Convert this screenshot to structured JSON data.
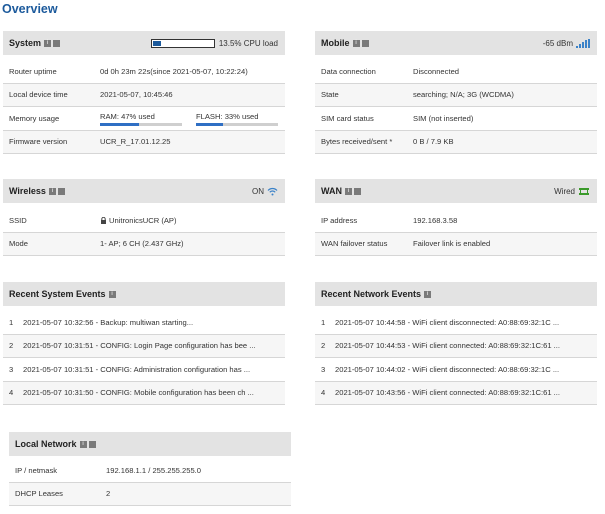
{
  "page_title": "Overview",
  "system": {
    "title": "System",
    "cpu_load_text": "13.5% CPU load",
    "cpu_load_fraction": 0.135,
    "rows": [
      {
        "label": "Router uptime",
        "value": "0d 0h 23m 22s(since 2021-05-07, 10:22:24)"
      },
      {
        "label": "Local device time",
        "value": "2021-05-07, 10:45:46"
      },
      {
        "label": "Memory usage",
        "ram_text": "RAM: 47% used",
        "ram_fraction": 0.47,
        "flash_text": "FLASH: 33% used",
        "flash_fraction": 0.33
      },
      {
        "label": "Firmware version",
        "value": "UCR_R_17.01.12.25"
      }
    ]
  },
  "mobile": {
    "title": "Mobile",
    "signal_text": "-65 dBm",
    "signal_icon": "signal-bars-icon",
    "rows": [
      {
        "label": "Data connection",
        "value": "Disconnected"
      },
      {
        "label": "State",
        "value": "searching; N/A; 3G (WCDMA)"
      },
      {
        "label": "SIM card status",
        "value": "SIM (not inserted)"
      },
      {
        "label": "Bytes received/sent *",
        "value": "0 B / 7.9 KB"
      }
    ]
  },
  "wireless": {
    "title": "Wireless",
    "status_text": "ON",
    "status_icon": "wifi-icon",
    "rows": [
      {
        "label": "SSID",
        "value": "UnitronicsUCR (AP)",
        "icon": "lock-icon"
      },
      {
        "label": "Mode",
        "value": "1- AP; 6 CH (2.437 GHz)"
      }
    ]
  },
  "wan": {
    "title": "WAN",
    "type_text": "Wired",
    "type_icon": "ethernet-icon",
    "rows": [
      {
        "label": "IP address",
        "value": "192.168.3.58"
      },
      {
        "label": "WAN failover status",
        "value": "Failover link is enabled"
      }
    ]
  },
  "system_events": {
    "title": "Recent System Events",
    "items": [
      {
        "num": "1",
        "text": "2021-05-07 10:32:56 - Backup: multiwan starting..."
      },
      {
        "num": "2",
        "text": "2021-05-07 10:31:51 - CONFIG: Login Page configuration has bee ..."
      },
      {
        "num": "3",
        "text": "2021-05-07 10:31:51 - CONFIG: Administration configuration has ..."
      },
      {
        "num": "4",
        "text": "2021-05-07 10:31:50 - CONFIG: Mobile configuration has been ch ..."
      }
    ]
  },
  "network_events": {
    "title": "Recent Network Events",
    "items": [
      {
        "num": "1",
        "text": "2021-05-07 10:44:58 - WiFi client disconnected: A0:88:69:32:1C ..."
      },
      {
        "num": "2",
        "text": "2021-05-07 10:44:53 - WiFi client connected: A0:88:69:32:1C:61 ..."
      },
      {
        "num": "3",
        "text": "2021-05-07 10:44:02 - WiFi client disconnected: A0:88:69:32:1C ..."
      },
      {
        "num": "4",
        "text": "2021-05-07 10:43:56 - WiFi client connected: A0:88:69:32:1C:61 ..."
      }
    ]
  },
  "local_network": {
    "title": "Local Network",
    "rows": [
      {
        "label": "IP / netmask",
        "value": "192.168.1.1 / 255.255.255.0"
      },
      {
        "label": "DHCP Leases",
        "value": "2"
      }
    ]
  },
  "icons": {
    "info": "i",
    "config": "■"
  },
  "colors": {
    "title_blue": "#1c5a9c",
    "bar_blue": "#2f6fc4",
    "wired_green": "#3a9a2a",
    "header_gray": "#e3e3e3"
  }
}
